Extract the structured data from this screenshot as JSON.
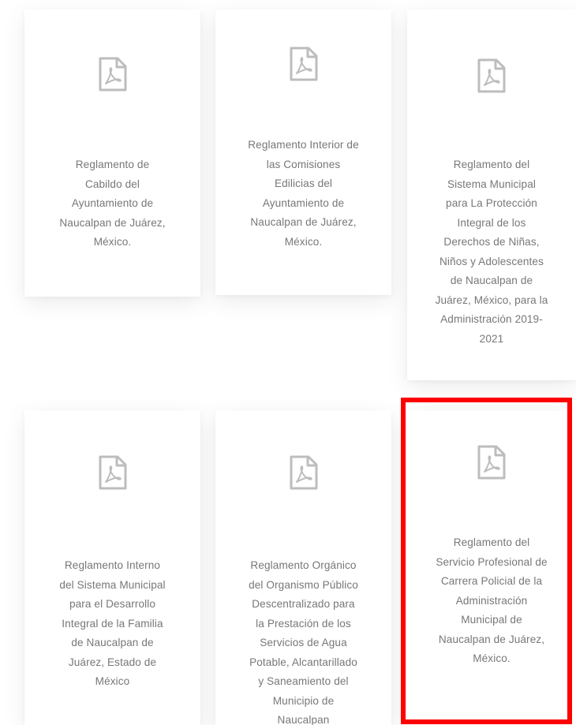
{
  "cards": [
    {
      "title": "Reglamento de\nCabildo del\nAyuntamiento de\nNaucalpan de Juárez,\nMéxico.",
      "icon": "pdf-file-icon"
    },
    {
      "title": "Reglamento Interior de\nlas Comisiones\nEdilicias del\nAyuntamiento de\nNaucalpan de Juárez,\nMéxico.",
      "icon": "pdf-file-icon"
    },
    {
      "title": "Reglamento del\nSistema Municipal\npara La Protección\nIntegral de los\nDerechos de Niñas,\nNiños y Adolescentes\nde Naucalpan de\nJuárez, México, para la\nAdministración 2019-\n2021",
      "icon": "pdf-file-icon"
    },
    {
      "title": "Reglamento Interno\ndel Sistema Municipal\npara el Desarrollo\nIntegral de la Familia\nde Naucalpan de\nJuárez, Estado de\nMéxico",
      "icon": "pdf-file-icon"
    },
    {
      "title": "Reglamento Orgánico\ndel Organismo Público\nDescentralizado para\nla Prestación de los\nServicios de Agua\nPotable, Alcantarillado\ny Saneamiento del\nMunicipio de\nNaucalpan",
      "icon": "pdf-file-icon"
    },
    {
      "title": "Reglamento del\nServicio Profesional de\nCarrera Policial de la\nAdministración\nMunicipal de\nNaucalpan de Juárez,\nMéxico.",
      "icon": "pdf-file-icon"
    }
  ],
  "colors": {
    "text": "#777777",
    "icon": "#bdbdbd",
    "highlight": "#ff0000"
  }
}
